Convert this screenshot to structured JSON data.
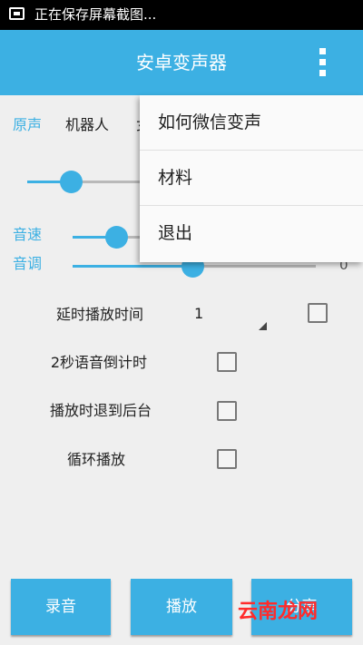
{
  "status_bar": {
    "text": "正在保存屏幕截图..."
  },
  "title_bar": {
    "title": "安卓变声器"
  },
  "voices": [
    "原声",
    "机器人",
    "女"
  ],
  "sliders": {
    "speed": {
      "label": "音速",
      "value_fraction": 0.18
    },
    "pitch": {
      "label": "音调",
      "value": "0",
      "value_fraction": 0.5
    },
    "top": {
      "value_fraction": 0.35
    }
  },
  "options": {
    "delay_label": "延时播放时间",
    "delay_value": "1",
    "countdown_label": "2秒语音倒计时",
    "background_label": "播放时退到后台",
    "loop_label": "循环播放"
  },
  "buttons": {
    "record": "录音",
    "play": "播放",
    "share": "分享"
  },
  "menu": [
    "如何微信变声",
    "材料",
    "退出"
  ],
  "watermark": "云南龙网",
  "colors": {
    "accent": "#3cb0e3",
    "watermark": "#ff2b2b"
  }
}
